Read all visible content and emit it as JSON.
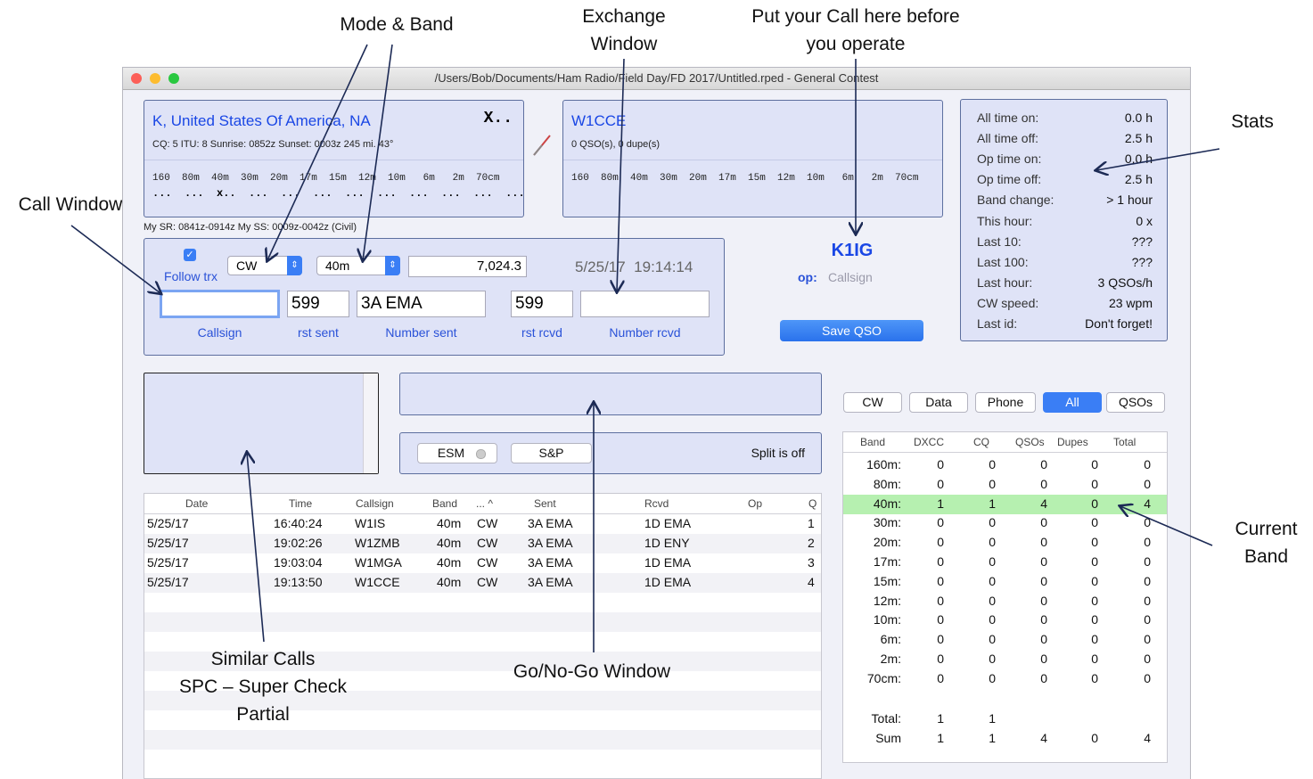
{
  "annotations": {
    "mode_band": "Mode & Band",
    "exchange_line1": "Exchange",
    "exchange_line2": "Window",
    "put_call_line1": "Put your Call here before",
    "put_call_line2": "you operate",
    "call_window": "Call Window",
    "stats": "Stats",
    "current_band_line1": "Current",
    "current_band_line2": "Band",
    "similar_line1": "Similar Calls",
    "similar_line2": "SPC – Super Check",
    "similar_line3": "Partial",
    "gonogo": "Go/No-Go Window"
  },
  "window": {
    "title": "/Users/Bob/Documents/Ham Radio/Field Day/FD 2017/Untitled.rped - General Contest"
  },
  "country_panel": {
    "name": "K, United States Of America, NA",
    "marker": "X..",
    "info": "CQ: 5  ITU: 8  Sunrise: 0852z  Sunset: 0003z  245 mi.  43°",
    "bands": "160  80m  40m  30m  20m  17m  15m  12m  10m   6m   2m  70cm",
    "marks": "...  ...  x..  ...  ...  ...  ...  ...  ...  ...  ...  ..."
  },
  "call_panel": {
    "call": "W1CCE",
    "counts": "0 QSO(s), 0 dupe(s)",
    "bands": "160  80m  40m  30m  20m  17m  15m  12m  10m   6m   2m  70cm"
  },
  "sun_line": "My SR: 0841z-0914z  My SS: 0009z-0042z (Civil)",
  "entry": {
    "follow_label": "Follow trx",
    "mode": "CW",
    "band": "40m",
    "frequency": "7,024.3",
    "datetime": "5/25/17  19:14:14",
    "callsign_value": "",
    "rst_sent": "599",
    "number_sent": "3A EMA",
    "rst_rcvd": "599",
    "number_rcvd_value": "",
    "labels": {
      "callsign": "Callsign",
      "rst_sent": "rst sent",
      "number_sent": "Number sent",
      "rst_rcvd": "rst rcvd",
      "number_rcvd": "Number rcvd"
    }
  },
  "operator": {
    "call": "K1IG",
    "op_label": "op:",
    "op_placeholder": "Callsign",
    "save_label": "Save QSO"
  },
  "stats": [
    {
      "label": "All time on:",
      "value": "0.0 h"
    },
    {
      "label": "All time off:",
      "value": "2.5 h"
    },
    {
      "label": "Op time on:",
      "value": "0.0 h"
    },
    {
      "label": "Op time off:",
      "value": "2.5 h"
    },
    {
      "label": "Band change:",
      "value": "> 1 hour"
    },
    {
      "label": "This hour:",
      "value": "0 x"
    },
    {
      "label": "Last 10:",
      "value": "???"
    },
    {
      "label": "Last 100:",
      "value": "???"
    },
    {
      "label": "Last hour:",
      "value": "3 QSOs/h"
    },
    {
      "label": "CW speed:",
      "value": "23 wpm"
    },
    {
      "label": "Last id:",
      "value": "Don't forget!"
    }
  ],
  "esm": {
    "esm_label": "ESM",
    "sp_label": "S&P",
    "split_text": "Split is off"
  },
  "filters": [
    "CW",
    "Data",
    "Phone",
    "All",
    "QSOs"
  ],
  "log": {
    "headers": [
      "Date",
      "Time",
      "Callsign",
      "Band",
      "...",
      "Sent",
      "Rcvd",
      "Op",
      "Q"
    ],
    "rows": [
      [
        "5/25/17",
        "16:40:24",
        "W1IS",
        "40m",
        "CW",
        "3A EMA",
        "1D EMA",
        "",
        "1"
      ],
      [
        "5/25/17",
        "19:02:26",
        "W1ZMB",
        "40m",
        "CW",
        "3A EMA",
        "1D ENY",
        "",
        "2"
      ],
      [
        "5/25/17",
        "19:03:04",
        "W1MGA",
        "40m",
        "CW",
        "3A EMA",
        "1D EMA",
        "",
        "3"
      ],
      [
        "5/25/17",
        "19:13:50",
        "W1CCE",
        "40m",
        "CW",
        "3A EMA",
        "1D EMA",
        "",
        "4"
      ]
    ]
  },
  "band_table": {
    "headers": [
      "Band",
      "DXCC",
      "CQ",
      "QSOs",
      "Dupes",
      "Total"
    ],
    "rows": [
      [
        "160m:",
        "0",
        "0",
        "0",
        "0",
        "0"
      ],
      [
        "80m:",
        "0",
        "0",
        "0",
        "0",
        "0"
      ],
      [
        "40m:",
        "1",
        "1",
        "4",
        "0",
        "4"
      ],
      [
        "30m:",
        "0",
        "0",
        "0",
        "0",
        "0"
      ],
      [
        "20m:",
        "0",
        "0",
        "0",
        "0",
        "0"
      ],
      [
        "17m:",
        "0",
        "0",
        "0",
        "0",
        "0"
      ],
      [
        "15m:",
        "0",
        "0",
        "0",
        "0",
        "0"
      ],
      [
        "12m:",
        "0",
        "0",
        "0",
        "0",
        "0"
      ],
      [
        "10m:",
        "0",
        "0",
        "0",
        "0",
        "0"
      ],
      [
        "6m:",
        "0",
        "0",
        "0",
        "0",
        "0"
      ],
      [
        "2m:",
        "0",
        "0",
        "0",
        "0",
        "0"
      ],
      [
        "70cm:",
        "0",
        "0",
        "0",
        "0",
        "0"
      ]
    ],
    "total": [
      "Total:",
      "1",
      "1",
      "",
      "",
      ""
    ],
    "sum": [
      "Sum",
      "1",
      "1",
      "4",
      "0",
      "4"
    ]
  },
  "colors": {
    "accent": "#1a47e5",
    "panel": "#dfe3f7",
    "current_band": "#b6f0b0",
    "button_blue": "#3a7ef5"
  }
}
